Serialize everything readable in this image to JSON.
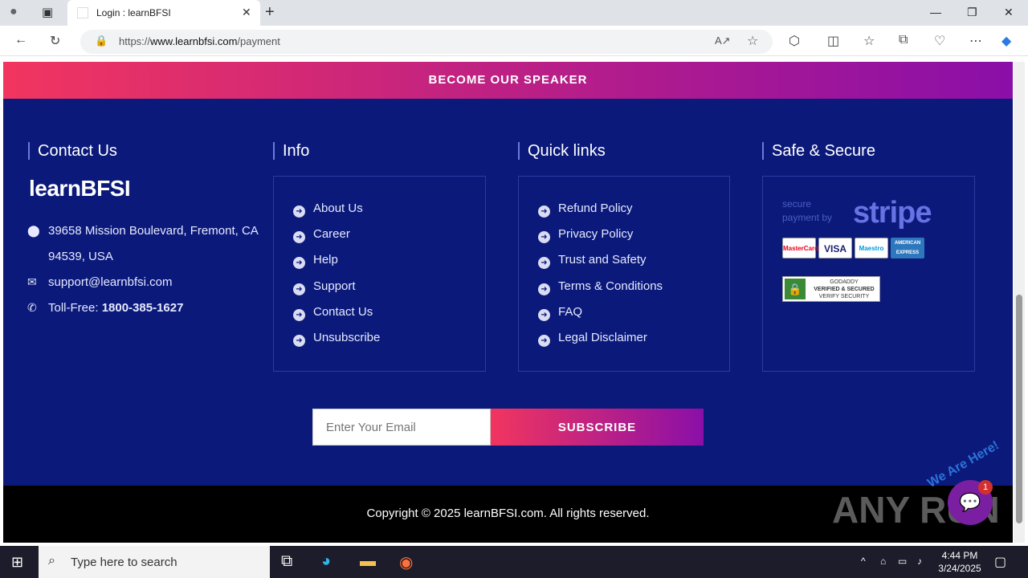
{
  "browser": {
    "tab_title": "Login : learnBFSI",
    "new_tab_label": "+",
    "tab_close": "✕",
    "url_prefix": "https://",
    "url_domain": "www.learnbfsi.com",
    "url_path": "/payment"
  },
  "page": {
    "speaker_band": "BECOME OUR SPEAKER",
    "contact": {
      "heading": "Contact Us",
      "logo": "learnBFSI",
      "address_line1": "39658 Mission Boulevard, Fremont, CA",
      "address_line2": "94539, USA",
      "email": "support@learnbfsi.com",
      "tollfree_label": "Toll-Free: ",
      "tollfree_number": "1800-385-1627"
    },
    "info": {
      "heading": "Info",
      "links": [
        "About Us",
        "Career",
        "Help",
        "Support",
        "Contact Us",
        "Unsubscribe"
      ]
    },
    "quick_links": {
      "heading": "Quick links",
      "links": [
        "Refund Policy",
        "Privacy Policy",
        "Trust and Safety",
        "Terms & Conditions",
        "FAQ",
        "Legal Disclaimer"
      ]
    },
    "safe": {
      "heading": "Safe & Secure",
      "stripe_line1": "secure",
      "stripe_line2": "payment by",
      "stripe_word": "stripe",
      "cards": [
        "MasterCard",
        "VISA",
        "Maestro",
        "AMERICAN EXPRESS"
      ],
      "godaddy_line1": "GODADDY",
      "godaddy_line2": "VERIFIED & SECURED",
      "godaddy_line3": "VERIFY SECURITY"
    },
    "newsletter": {
      "email_placeholder": "Enter Your Email",
      "subscribe_label": "SUBSCRIBE"
    },
    "copyright": "Copyright © 2025 learnBFSI.com. All rights reserved.",
    "chat": {
      "text": "We Are Here!",
      "count": "1"
    },
    "watermark": "ANY RUN"
  },
  "taskbar": {
    "search_placeholder": "Type here to search",
    "time": "4:44 PM",
    "date": "3/24/2025"
  }
}
